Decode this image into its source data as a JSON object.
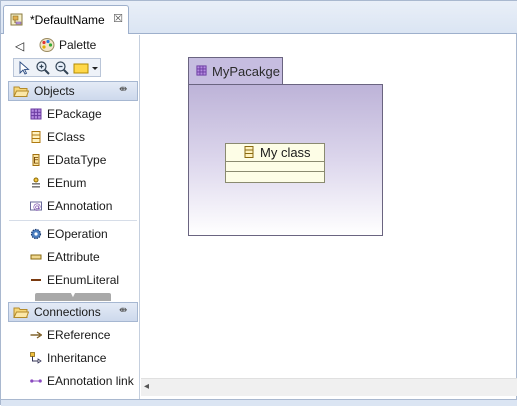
{
  "editor_tab": {
    "title": "*DefaultName",
    "close_glyph": "☒"
  },
  "palette": {
    "title": "Palette",
    "collapse_glyph": "◁",
    "tools": [
      "select-tool",
      "zoom-in-tool",
      "zoom-out-tool",
      "note-tool"
    ],
    "drawers": [
      {
        "label": "Objects",
        "pin_glyph": "⇼",
        "entries": [
          {
            "label": "EPackage",
            "icon": "epackage-icon"
          },
          {
            "label": "EClass",
            "icon": "eclass-icon"
          },
          {
            "label": "EDataType",
            "icon": "edatatype-icon"
          },
          {
            "label": "EEnum",
            "icon": "eenum-icon"
          },
          {
            "label": "EAnnotation",
            "icon": "eannotation-icon"
          },
          {
            "label": "EOperation",
            "icon": "eoperation-icon"
          },
          {
            "label": "EAttribute",
            "icon": "eattribute-icon"
          },
          {
            "label": "EEnumLiteral",
            "icon": "eenumliteral-icon"
          }
        ]
      },
      {
        "label": "Connections",
        "pin_glyph": "⇼",
        "entries": [
          {
            "label": "EReference",
            "icon": "ereference-icon"
          },
          {
            "label": "Inheritance",
            "icon": "inheritance-icon"
          },
          {
            "label": "EAnnotation link",
            "icon": "eannotation-link-icon"
          }
        ]
      }
    ]
  },
  "canvas": {
    "package": {
      "name": "MyPacakge",
      "color": "#c6bde0"
    },
    "class": {
      "name": "My class",
      "color": "#fdfde6"
    }
  },
  "scrollbar": {
    "left_glyph": "◂"
  }
}
